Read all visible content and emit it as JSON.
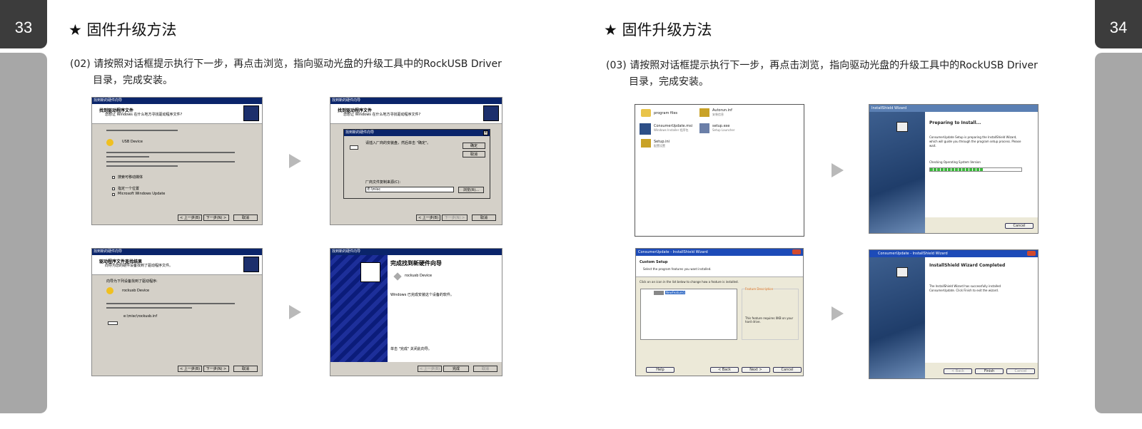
{
  "left_page": {
    "page_number": "33",
    "title": "★ 固件升级方法",
    "instruction_line1": "(02) 请按照对话框提示执行下一步，再点击浏览，指向驱动光盘的升级工具中的RockUSB Driver",
    "instruction_line2": "目录，完成安装。"
  },
  "right_page": {
    "page_number": "34",
    "title": "★ 固件升级方法",
    "instruction_line1": "(03) 请按照对话框提示执行下一步，再点击浏览，指向驱动光盘的升级工具中的RockUSB Driver",
    "instruction_line2": "目录，完成安装。"
  },
  "screens": {
    "s1": {
      "titlebar": "找到新的硬件向导",
      "header_title": "找到驱动程序文件",
      "header_sub": "您想让 Windows 在什么地方寻找驱动程序文件?",
      "device": "USB Device",
      "opt1": "搜索可移动媒体",
      "opt2": "指定一个位置",
      "opt3": "Microsoft Windows Update",
      "back": "< 上一步(B)",
      "next": "下一步(N) >",
      "cancel": "取消"
    },
    "s2": {
      "titlebar": "找到新的硬件向导",
      "header_title": "找到驱动程序文件",
      "header_sub": "您想让 Windows 在什么地方寻找驱动程序文件?",
      "inner_title": "找到新的硬件向导",
      "inner_msg": "请插入厂商的安装盘，然后单击 \"确定\"。",
      "ok": "确定",
      "inner_cancel": "取消",
      "copy_label": "厂商文件复制来源(C):",
      "path": "E:\\misc",
      "browse": "浏览(R)...",
      "back": "< 上一步(B)",
      "next": "下一步(N) >",
      "cancel": "取消"
    },
    "s3": {
      "titlebar": "找到新的硬件向导",
      "header_title": "驱动程序文件查找结果",
      "header_sub": "向导为您的硬件设备找到了驱动程序文件。",
      "found_label": "向导为下列设备找到了驱动程序:",
      "device": "rockusb Device",
      "path": "e:\\misc\\rockusb.inf",
      "back": "< 上一步(B)",
      "next": "下一步(N) >",
      "cancel": "取消"
    },
    "s4": {
      "titlebar": "找到新的硬件向导",
      "heading": "完成找到新硬件向导",
      "device": "rockusb Device",
      "msg": "Windows 已完成安装这个设备的软件。",
      "footer": "单击 \"完成\" 关闭此向导。",
      "back": "< 上一步(B)",
      "finish": "完成",
      "cancel": "取消"
    },
    "s5": {
      "files": [
        {
          "name": "program files",
          "sub": ""
        },
        {
          "name": "Autorun.inf",
          "sub": "安装信息"
        },
        {
          "name": "ConsumerUpdate.msi",
          "sub": "Windows Installer 程序包"
        },
        {
          "name": "setup.exe",
          "sub": "Setup Launcher"
        },
        {
          "name": "Setup.ini",
          "sub": "配置设置"
        }
      ]
    },
    "s6": {
      "titlebar": "InstallShield Wizard",
      "heading": "Preparing to Install...",
      "msg": "ConsumerUpdate Setup is preparing the InstallShield Wizard, which will guide you through the program setup process. Please wait.",
      "status": "Checking Operating System Version",
      "progress": 0.58,
      "cancel": "Cancel"
    },
    "s7": {
      "titlebar": "ConsumerUpdate - InstallShield Wizard",
      "heading": "Custom Setup",
      "sub": "Select the program features you want installed.",
      "hint": "Click on an icon in the list below to change how a feature is installed.",
      "feature": "NewFeature1",
      "desc_label": "Feature Description",
      "desc": "This feature requires 0KB on your hard drive.",
      "help": "Help",
      "back": "< Back",
      "next": "Next >",
      "cancel": "Cancel"
    },
    "s8": {
      "titlebar": "ConsumerUpdate - InstallShield Wizard",
      "heading": "InstallShield Wizard Completed",
      "msg": "The InstallShield Wizard has successfully installed ConsumerUpdate. Click Finish to exit the wizard.",
      "back": "< Back",
      "finish": "Finish",
      "cancel": "Cancel"
    }
  }
}
